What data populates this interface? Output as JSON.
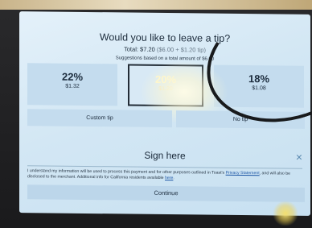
{
  "prompt": {
    "title": "Would you like to leave a tip?",
    "total": "Total: $7.20",
    "breakdown": "($6.00 + $1.20 tip)",
    "suggestions": "Suggestions based on a total amount of $6.00"
  },
  "tips": [
    {
      "percent": "22%",
      "amount": "$1.32"
    },
    {
      "percent": "20%",
      "amount": "$1.20"
    },
    {
      "percent": "18%",
      "amount": "$1.08"
    }
  ],
  "buttons": {
    "custom_tip": "Custom tip",
    "no_tip": "No tip",
    "continue": "Continue"
  },
  "signature": {
    "label": "Sign here",
    "close_icon": "×"
  },
  "disclaimer": {
    "text_a": "I understand my information will be used to process this payment and for other purposes outlined in Toast's ",
    "link_privacy": "Privacy Statement",
    "text_b": ", and will also be disclosed to the merchant. Additional info for California residents available ",
    "link_here": "here",
    "text_c": "."
  },
  "colors": {
    "screen_bg": "#d3e7f4",
    "tile_bg": "#c4dcee",
    "selected_border": "#222c36",
    "link": "#1e57a6"
  }
}
